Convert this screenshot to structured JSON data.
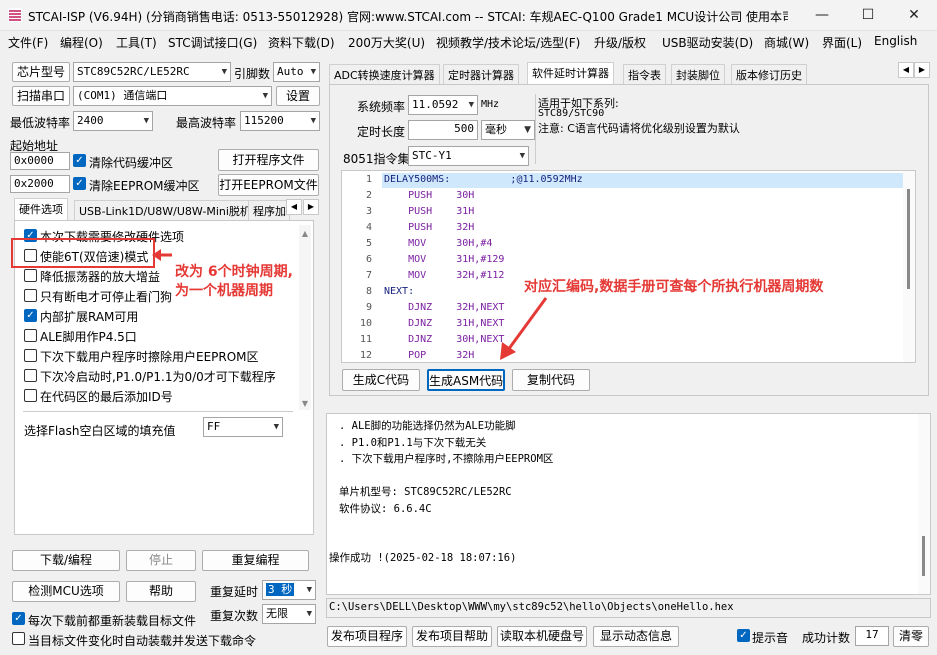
{
  "window": {
    "title": "STCAI-ISP (V6.94H) (分销商销售电话: 0513-55012928) 官网:www.STCAI.com  -- STCAI: 车规AEC-Q100 Grade1 MCU设计公司 使用本司芯片或采...",
    "min": "—",
    "max": "☐",
    "close": "✕"
  },
  "menu": [
    "文件(F)",
    "编程(O)",
    "工具(T)",
    "STC调试接口(G)",
    "资料下载(D)",
    "200万大奖(U)",
    "视频教学/技术论坛/选型(F)",
    "升级/版权",
    "USB驱动安装(D)",
    "商城(W)",
    "界面(L)",
    "English"
  ],
  "left": {
    "chip_label": "芯片型号",
    "chip_value": "STC89C52RC/LE52RC",
    "pin_label": "引脚数",
    "pin_value": "Auto",
    "scan_btn": "扫描串口",
    "port_value": "(COM1) 通信端口",
    "settings_btn": "设置",
    "min_baud_label": "最低波特率",
    "min_baud": "2400",
    "max_baud_label": "最高波特率",
    "max_baud": "115200",
    "start_addr_label": "起始地址",
    "addr1": "0x0000",
    "clear_code": "清除代码缓冲区",
    "open_prog": "打开程序文件",
    "addr2": "0x2000",
    "clear_eeprom": "清除EEPROM缓冲区",
    "open_eeprom": "打开EEPROM文件",
    "tabs": [
      "硬件选项",
      "USB-Link1D/U8W/U8W-Mini脱机",
      "程序加"
    ],
    "options": [
      {
        "label": "本次下载需要修改硬件选项",
        "checked": true
      },
      {
        "label": "使能6T(双倍速)模式",
        "checked": false
      },
      {
        "label": "降低振荡器的放大增益",
        "checked": false
      },
      {
        "label": "只有断电才可停止看门狗",
        "checked": false
      },
      {
        "label": "内部扩展RAM可用",
        "checked": true
      },
      {
        "label": "ALE脚用作P4.5口",
        "checked": false
      },
      {
        "label": "下次下载用户程序时擦除用户EEPROM区",
        "checked": false
      },
      {
        "label": "下次冷启动时,P1.0/P1.1为0/0才可下载程序",
        "checked": false
      },
      {
        "label": "在代码区的最后添加ID号",
        "checked": false
      }
    ],
    "fill_label": "选择Flash空白区域的填充值",
    "fill_value": "FF",
    "download_btn": "下载/编程",
    "stop_btn": "停止",
    "reprogram_btn": "重复编程",
    "check_mcu_btn": "检测MCU选项",
    "help_btn": "帮助",
    "repeat_delay_label": "重复延时",
    "repeat_delay": "3 秒",
    "repeat_count_label": "重复次数",
    "repeat_count": "无限",
    "reload_each": "每次下载前都重新装载目标文件",
    "auto_send": "当目标文件变化时自动装载并发送下载命令"
  },
  "annotation1": [
    "改为 6个时钟周期,",
    "为一个机器周期"
  ],
  "annotation2": "对应汇编码,数据手册可查每个所执行机器周期数",
  "right": {
    "tabs": [
      "ADC转换速度计算器",
      "定时器计算器",
      "软件延时计算器",
      "指令表",
      "封装脚位",
      "版本修订历史"
    ],
    "freq_label": "系统频率",
    "freq_value": "11.0592",
    "freq_unit": "MHz",
    "delay_label": "定时长度",
    "delay_value": "500",
    "delay_unit": "毫秒",
    "isa_label": "8051指令集",
    "isa_value": "STC-Y1",
    "desc": [
      "适用于如下系列:",
      "STC89/STC90",
      "注意: C语言代码请将优化级别设置为默认"
    ],
    "code": [
      {
        "n": "1",
        "t": "DELAY500MS:          ;@11.0592MHz"
      },
      {
        "n": "2",
        "t": "    PUSH    30H"
      },
      {
        "n": "3",
        "t": "    PUSH    31H"
      },
      {
        "n": "4",
        "t": "    PUSH    32H"
      },
      {
        "n": "5",
        "t": "    MOV     30H,#4"
      },
      {
        "n": "6",
        "t": "    MOV     31H,#129"
      },
      {
        "n": "7",
        "t": "    MOV     32H,#112"
      },
      {
        "n": "8",
        "t": "NEXT:"
      },
      {
        "n": "9",
        "t": "    DJNZ    32H,NEXT"
      },
      {
        "n": "10",
        "t": "    DJNZ    31H,NEXT"
      },
      {
        "n": "11",
        "t": "    DJNZ    30H,NEXT"
      },
      {
        "n": "12",
        "t": "    POP     32H"
      }
    ],
    "gen_c": "生成C代码",
    "gen_asm": "生成ASM代码",
    "copy_code": "复制代码",
    "log": [
      ". ALE脚的功能选择仍然为ALE功能脚",
      ". P1.0和P1.1与下次下载无关",
      ". 下次下载用户程序时,不擦除用户EEPROM区",
      "",
      "单片机型号: STC89C52RC/LE52RC",
      "软件协议: 6.6.4C",
      "",
      "",
      "操作成功 !(2025-02-18 18:07:16)"
    ],
    "filepath": "C:\\Users\\DELL\\Desktop\\WWW\\my\\stc89c52\\hello\\Objects\\oneHello.hex",
    "publish_prog": "发布项目程序",
    "publish_help": "发布项目帮助",
    "read_serial": "读取本机硬盘号",
    "show_dynamic": "显示动态信息",
    "beep": "提示音",
    "success_label": "成功计数",
    "success_count": "17",
    "clear_btn": "清零"
  }
}
